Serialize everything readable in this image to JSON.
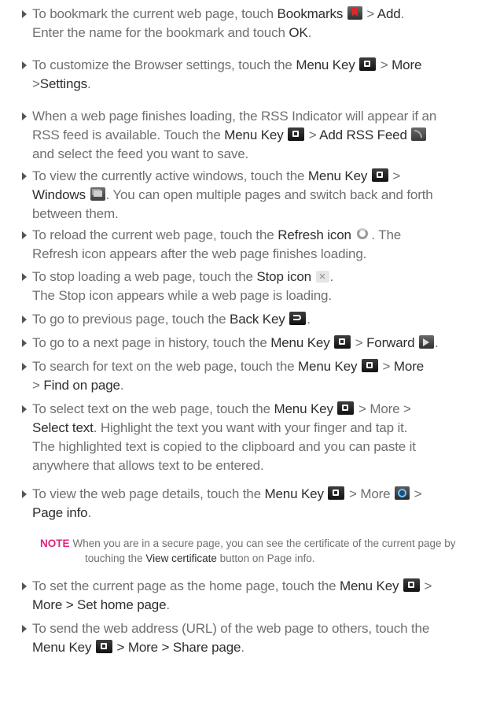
{
  "items": [
    {
      "l1": [
        "To bookmark the current web page, touch ",
        "Bookmarks",
        " > ",
        "Add",
        "."
      ],
      "l2": [
        "Enter the name for the bookmark and touch ",
        "OK",
        "."
      ]
    },
    {
      "l1": [
        "To customize the Browser settings, touch the ",
        "Menu Key",
        " > ",
        "More"
      ],
      "l2": [
        ">",
        "Settings",
        "."
      ]
    },
    {
      "l1": [
        "When a web page finishes loading, the RSS Indicator will appear if an"
      ],
      "l2": [
        "RSS feed is available. Touch the ",
        "Menu Key",
        " > ",
        "Add RSS Feed"
      ],
      "l3": [
        "and select the feed you want to save."
      ]
    },
    {
      "l1": [
        "To view the currently active windows, touch the ",
        "Menu Key",
        " >"
      ],
      "l2": [
        "Windows",
        ". You can open multiple pages and switch back and forth"
      ],
      "l3": [
        "between them."
      ]
    },
    {
      "l1": [
        "To reload the current web page, touch the ",
        "Refresh icon",
        ". The"
      ],
      "l2": [
        "Refresh icon appears after the web page finishes loading."
      ]
    },
    {
      "l1": [
        "To stop loading a web page, touch the ",
        "Stop icon",
        "."
      ],
      "l2": [
        "The Stop icon appears while a web page is loading."
      ]
    },
    {
      "l1": [
        "To go to previous page, touch the ",
        "Back Key",
        "."
      ]
    },
    {
      "l1": [
        "To go to a next page in history, touch the ",
        "Menu Key",
        " > ",
        "Forward",
        "."
      ]
    },
    {
      "l1": [
        "To search for text on the web page, touch the ",
        "Menu Key",
        " > ",
        "More"
      ],
      "l2": [
        "> ",
        "Find on page",
        "."
      ]
    },
    {
      "l1": [
        "To select text on the web page, touch the ",
        "Menu Key",
        " > More >"
      ],
      "l2": [
        "Select text",
        ". Highlight the text you want with your finger and tap it."
      ],
      "l3": [
        "The highlighted text is copied to the clipboard and you can paste it"
      ],
      "l4": [
        "anywhere that allows text to be entered."
      ]
    },
    {
      "l1": [
        "To view the web page details, touch the ",
        "Menu Key",
        " > More ",
        " >"
      ],
      "l2": [
        "Page info",
        "."
      ]
    },
    {
      "l1": [
        "To set the current page as the home page, touch the ",
        "Menu Key",
        " >"
      ],
      "l2": [
        "More > Set home page",
        "."
      ]
    },
    {
      "l1": [
        "To send the web address (URL) of the web page to others, touch the"
      ],
      "l2": [
        "Menu Key",
        " > More > Share page",
        "."
      ]
    }
  ],
  "note": {
    "label": "NOTE",
    "l1": "When you are in a secure page, you can see the certificate of the current page by",
    "l2a": "touching the ",
    "l2b": "View certificate",
    "l2c": " button on Page info."
  },
  "icons": [
    "bookmark-icon",
    "menu-key-icon",
    "rss-feed-icon",
    "windows-icon",
    "refresh-icon",
    "stop-icon",
    "back-key-icon",
    "forward-icon",
    "page-info-icon"
  ]
}
